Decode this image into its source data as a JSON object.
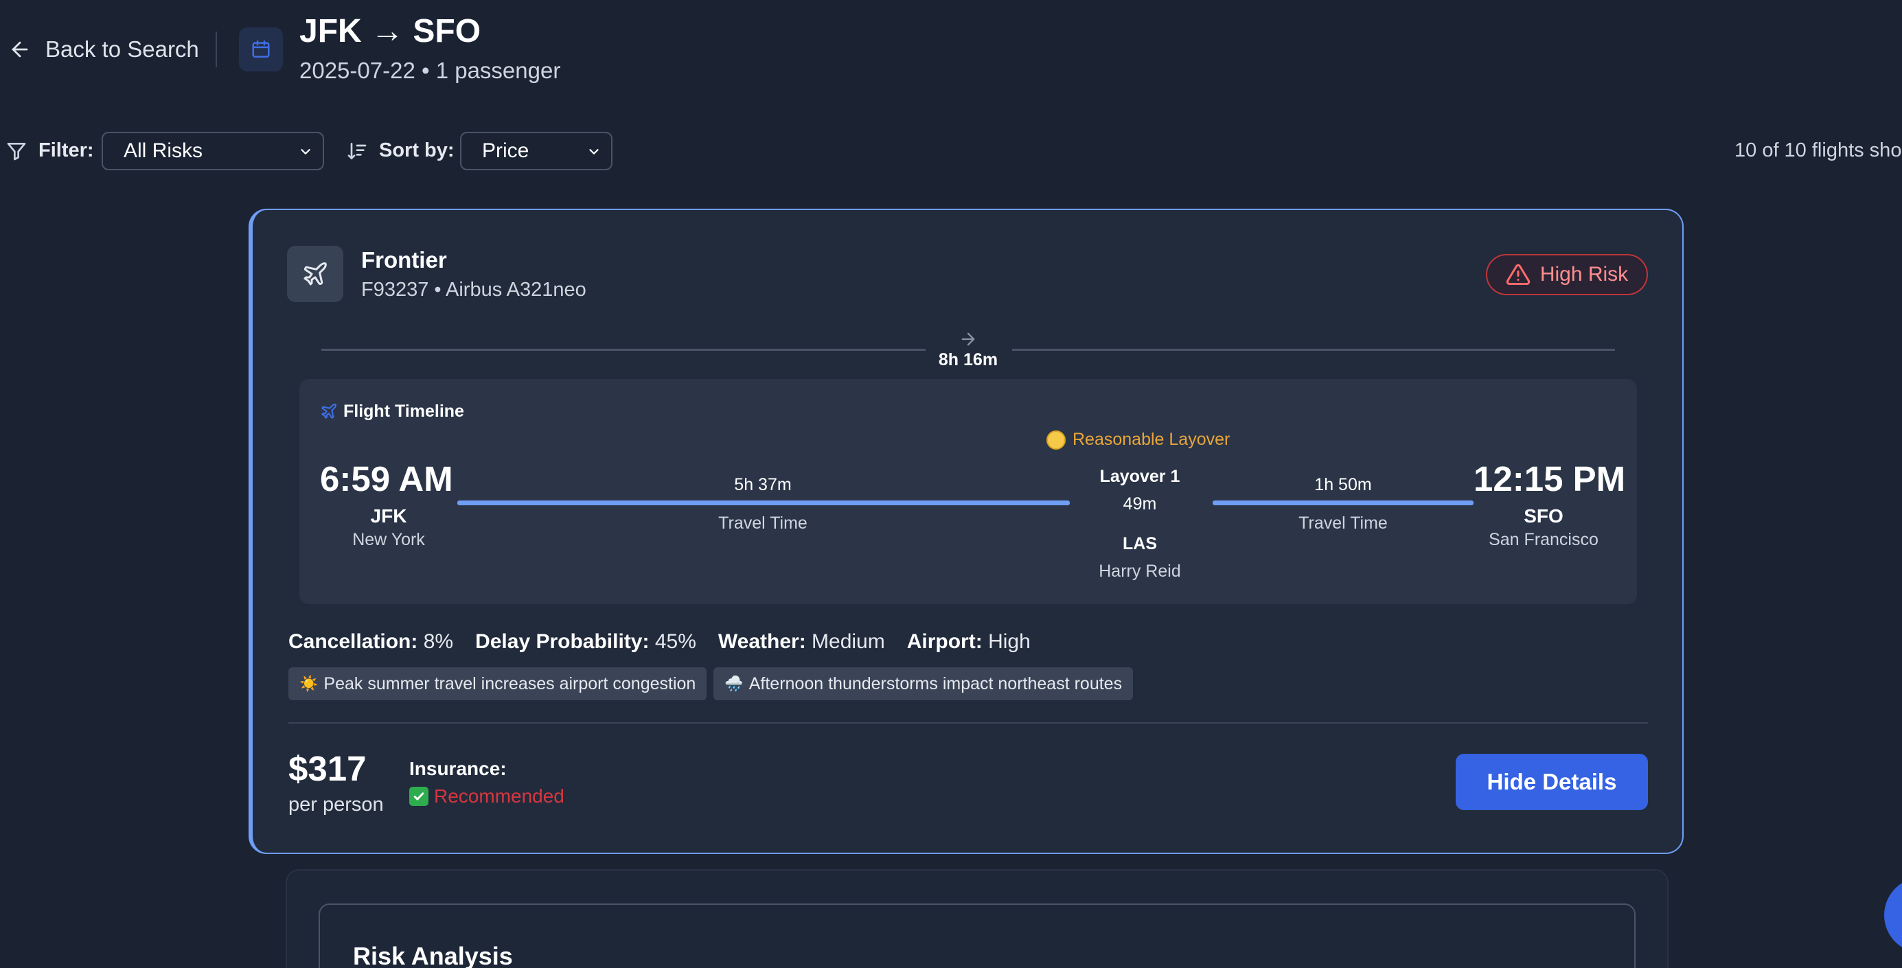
{
  "header": {
    "back_label": "Back to Search",
    "route": "JFK → SFO",
    "subtitle": "2025-07-22 • 1 passenger"
  },
  "toolbar": {
    "filter_label": "Filter:",
    "filter_value": "All Risks",
    "sort_label": "Sort by:",
    "sort_value": "Price",
    "results_count": "10 of 10 flights sho"
  },
  "flight": {
    "airline": "Frontier",
    "flight_info": "F93237 • Airbus A321neo",
    "risk_badge": "High Risk",
    "total_duration": "8h 16m",
    "timeline": {
      "title": "Flight Timeline",
      "layover_note": "Reasonable Layover",
      "departure": {
        "time": "6:59 AM",
        "code": "JFK",
        "city": "New York"
      },
      "arrival": {
        "time": "12:15 PM",
        "code": "SFO",
        "city": "San Francisco"
      },
      "segments": [
        {
          "duration": "5h 37m",
          "label": "Travel Time"
        },
        {
          "duration": "1h 50m",
          "label": "Travel Time"
        }
      ],
      "layover": {
        "title": "Layover 1",
        "duration": "49m",
        "code": "LAS",
        "airport": "Harry Reid"
      }
    },
    "risk_stats": [
      {
        "label": "Cancellation:",
        "value": "8%"
      },
      {
        "label": "Delay Probability:",
        "value": "45%"
      },
      {
        "label": "Weather:",
        "value": "Medium"
      },
      {
        "label": "Airport:",
        "value": "High"
      }
    ],
    "factors": [
      {
        "icon": "☀️",
        "text": "Peak summer travel increases airport congestion"
      },
      {
        "icon": "🌧️",
        "text": "Afternoon thunderstorms impact northeast routes"
      }
    ],
    "price": "$317",
    "price_unit": "per person",
    "insurance_label": "Insurance:",
    "insurance_value": "Recommended",
    "toggle_button": "Hide Details"
  },
  "details": {
    "risk_title": "Risk Analysis"
  },
  "colors": {
    "background": "#1b2333",
    "card": "#212b3c",
    "accent": "#6f9ef5",
    "primary_button": "#3563e3",
    "high_risk": "#c0353a",
    "layover_note": "#e9a53a",
    "recommended": "#d9363e"
  },
  "icons": {
    "back": "arrow-left-icon",
    "calendar": "calendar-icon",
    "filter": "filter-icon",
    "sort": "sort-icon",
    "airline": "plane-icon",
    "risk": "warning-triangle-icon",
    "duration": "arrow-right-icon",
    "timeline": "plane-icon",
    "layover": "yellow-circle-icon",
    "insurance": "check-box-icon"
  }
}
